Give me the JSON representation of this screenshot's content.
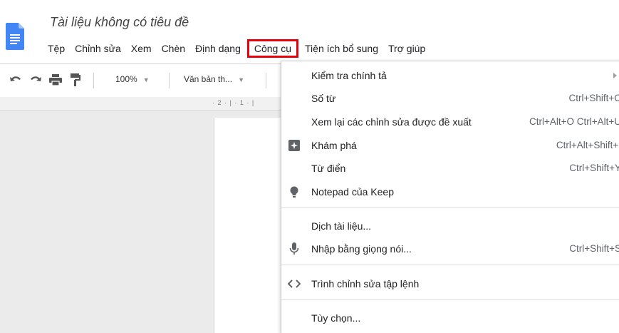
{
  "document": {
    "title": "Tài liệu không có tiêu đề"
  },
  "menubar": {
    "items": [
      {
        "label": "Tệp"
      },
      {
        "label": "Chỉnh sửa"
      },
      {
        "label": "Xem"
      },
      {
        "label": "Chèn"
      },
      {
        "label": "Định dạng"
      },
      {
        "label": "Công cụ"
      },
      {
        "label": "Tiện ích bổ sung"
      },
      {
        "label": "Trợ giúp"
      }
    ],
    "open_item": "Công cụ",
    "highlight_color": "#e8000d"
  },
  "toolbar": {
    "zoom": "100%",
    "style": "Văn bản th...",
    "icons": [
      "undo-icon",
      "redo-icon",
      "print-icon",
      "paint-format-icon"
    ]
  },
  "ruler": {
    "marks": "· 2 · | · 1 · |"
  },
  "tools_menu": {
    "items": [
      {
        "label": "Kiểm tra chính tả",
        "shortcut": "",
        "icon": "",
        "submenu": true
      },
      {
        "label": "Số từ",
        "shortcut": "Ctrl+Shift+C",
        "icon": ""
      },
      {
        "label": "Xem lại các chỉnh sửa được đề xuất",
        "shortcut": "Ctrl+Alt+O Ctrl+Alt+U",
        "icon": ""
      },
      {
        "label": "Khám phá",
        "shortcut": "Ctrl+Alt+Shift+I",
        "icon": "explore-icon"
      },
      {
        "label": "Từ điển",
        "shortcut": "Ctrl+Shift+Y",
        "icon": ""
      },
      {
        "label": "Notepad của Keep",
        "shortcut": "",
        "icon": "keep-bulb-icon"
      },
      {
        "label": "Dịch tài liệu...",
        "shortcut": "",
        "icon": ""
      },
      {
        "label": "Nhập bằng giọng nói...",
        "shortcut": "Ctrl+Shift+S",
        "icon": "microphone-icon"
      },
      {
        "label": "Trình chỉnh sửa tập lệnh",
        "shortcut": "",
        "icon": "code-brackets-icon"
      },
      {
        "label": "Tùy chọn...",
        "shortcut": "",
        "icon": ""
      }
    ]
  },
  "colors": {
    "doc_blue": "#4285f4",
    "menu_text": "#202124",
    "shortcut_text": "#5f6368",
    "canvas_bg": "#ebebeb"
  }
}
